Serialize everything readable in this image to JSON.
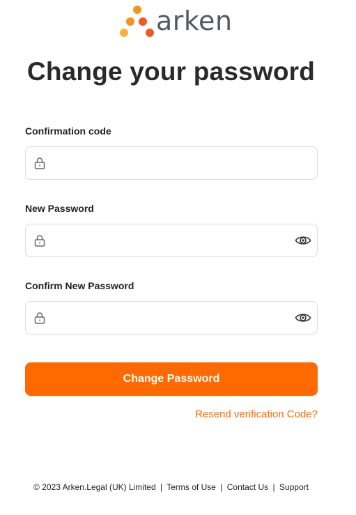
{
  "brand": {
    "name": "arken"
  },
  "page": {
    "title": "Change your password"
  },
  "form": {
    "confirmation_code": {
      "label": "Confirmation code",
      "value": ""
    },
    "new_password": {
      "label": "New Password",
      "value": ""
    },
    "confirm_password": {
      "label": "Confirm New Password",
      "value": ""
    },
    "submit_label": "Change Password",
    "resend_link": "Resend verification Code?"
  },
  "footer": {
    "copyright": "© 2023 Arken.Legal (UK) Limited",
    "separator": "|",
    "links": [
      "Terms of Use",
      "Contact Us",
      "Support"
    ]
  },
  "colors": {
    "accent": "#ff6a00",
    "logo_dots": [
      "#f7941d",
      "#f15a24",
      "#fbb03b"
    ],
    "border": "#dcdcdc"
  },
  "icons": [
    "lock-icon",
    "eye-icon"
  ]
}
